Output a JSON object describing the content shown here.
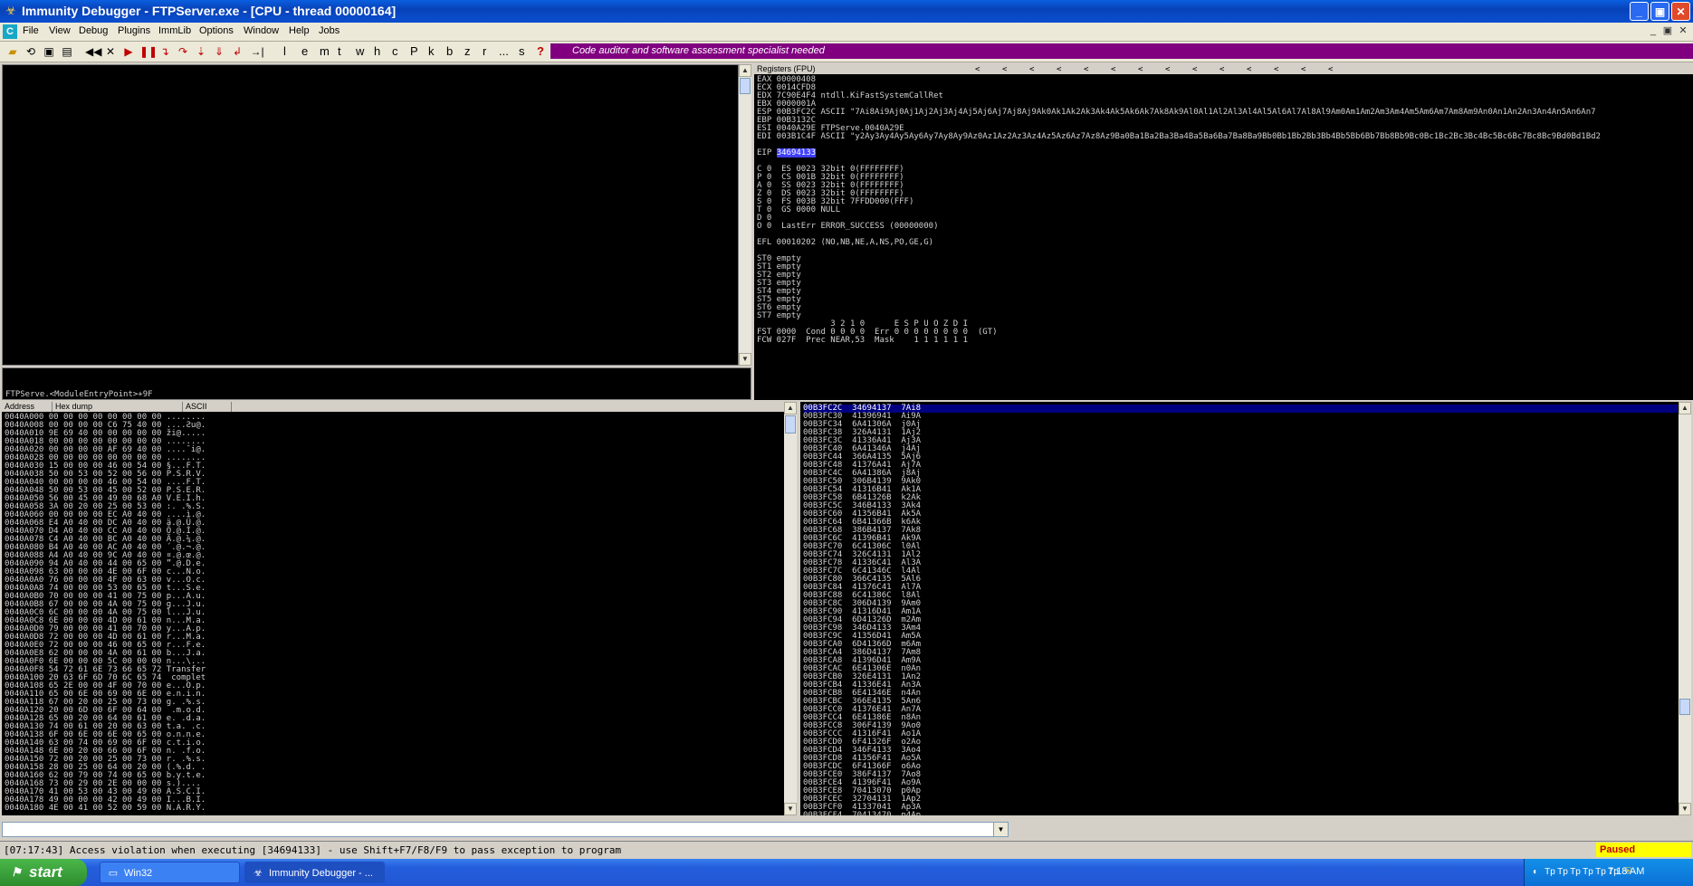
{
  "window": {
    "title": "Immunity Debugger - FTPServer.exe - [CPU - thread 00000164]",
    "minimize": "_",
    "maximize": "▣",
    "close": "✕"
  },
  "menu": {
    "items": [
      "File",
      "View",
      "Debug",
      "Plugins",
      "ImmLib",
      "Options",
      "Window",
      "Help",
      "Jobs"
    ],
    "mdi_controls": [
      "_",
      "▣",
      "✕"
    ]
  },
  "toolbar": {
    "letters": [
      "l",
      "e",
      "m",
      "t",
      "w",
      "h",
      "c",
      "P",
      "k",
      "b",
      "z",
      "r",
      "...",
      "s"
    ],
    "help": "?",
    "banner": "Code auditor and software assessment specialist needed"
  },
  "disasm": {
    "status_line": "FTPServe.<ModuleEntryPoint>+9F"
  },
  "registers": {
    "header": "Registers (FPU)",
    "nav_arrows": [
      "<",
      "<",
      "<",
      "<",
      "<",
      "<",
      "<",
      "<",
      "<",
      "<",
      "<",
      "<",
      "<",
      "<"
    ],
    "lines": [
      "EAX 00000408",
      "ECX 0014CFD8",
      "EDX 7C90E4F4 ntdll.KiFastSystemCallRet",
      "EBX 0000001A",
      "ESP 00B3FC2C ASCII \"7Ai8Ai9Aj0Aj1Aj2Aj3Aj4Aj5Aj6Aj7Aj8Aj9Ak0Ak1Ak2Ak3Ak4Ak5Ak6Ak7Ak8Ak9Al0Al1Al2Al3Al4Al5Al6Al7Al8Al9Am0Am1Am2Am3Am4Am5Am6Am7Am8Am9An0An1An2An3An4An5An6An7",
      "EBP 00B3132C",
      "ESI 0040A29E FTPServe.0040A29E",
      "EDI 003B1C4F ASCII \"y2Ay3Ay4Ay5Ay6Ay7Ay8Ay9Az0Az1Az2Az3Az4Az5Az6Az7Az8Az9Ba0Ba1Ba2Ba3Ba4Ba5Ba6Ba7Ba8Ba9Bb0Bb1Bb2Bb3Bb4Bb5Bb6Bb7Bb8Bb9Bc0Bc1Bc2Bc3Bc4Bc5Bc6Bc7Bc8Bc9Bd0Bd1Bd2",
      "",
      "EIP 34694133",
      "",
      "C 0  ES 0023 32bit 0(FFFFFFFF)",
      "P 0  CS 001B 32bit 0(FFFFFFFF)",
      "A 0  SS 0023 32bit 0(FFFFFFFF)",
      "Z 0  DS 0023 32bit 0(FFFFFFFF)",
      "S 0  FS 003B 32bit 7FFDD000(FFF)",
      "T 0  GS 0000 NULL",
      "D 0",
      "O 0  LastErr ERROR_SUCCESS (00000000)",
      "",
      "EFL 00010202 (NO,NB,NE,A,NS,PO,GE,G)",
      "",
      "ST0 empty",
      "ST1 empty",
      "ST2 empty",
      "ST3 empty",
      "ST4 empty",
      "ST5 empty",
      "ST6 empty",
      "ST7 empty",
      "               3 2 1 0      E S P U O Z D I",
      "FST 0000  Cond 0 0 0 0  Err 0 0 0 0 0 0 0 0  (GT)",
      "FCW 027F  Prec NEAR,53  Mask    1 1 1 1 1 1"
    ]
  },
  "hexdump": {
    "headers": [
      "Address",
      "Hex dump",
      "ASCII"
    ],
    "lines": [
      "0040A000 00 00 00 00 00 00 00 00 ........",
      "0040A008 00 00 00 00 C6 75 40 00 ....Ƨu@.",
      "0040A010 9E 69 40 00 00 00 00 00 ži@.....",
      "0040A018 00 00 00 00 00 00 00 00 ........",
      "0040A020 00 00 00 00 AF 69 40 00 ....¯i@.",
      "0040A028 00 00 00 00 00 00 00 00 ........",
      "0040A030 15 00 00 00 46 00 54 00 §...F.T.",
      "0040A038 50 00 53 00 52 00 56 00 P.S.R.V.",
      "0040A040 00 00 00 00 46 00 54 00 ....F.T.",
      "0040A048 50 00 53 00 45 00 52 00 P.S.E.R.",
      "0040A050 56 00 45 00 49 00 68 A0 V.E.I.h.",
      "0040A058 3A 00 20 00 25 00 53 00 :. .%.S.",
      "0040A060 00 00 00 00 EC A0 40 00 ....ì.@.",
      "0040A068 E4 A0 40 00 DC A0 40 00 ä.@.Ü.@.",
      "0040A070 D4 A0 40 00 CC A0 40 00 Ô.@.Ì.@.",
      "0040A078 C4 A0 40 00 BC A0 40 00 Ä.@.¼.@.",
      "0040A080 B4 A0 40 00 AC A0 40 00 ´.@.¬.@.",
      "0040A088 A4 A0 40 00 9C A0 40 00 ¤.@.œ.@.",
      "0040A090 94 A0 40 00 44 00 65 00 ”.@.D.e.",
      "0040A098 63 00 00 00 4E 00 6F 00 c...N.o.",
      "0040A0A0 76 00 00 00 4F 00 63 00 v...O.c.",
      "0040A0A8 74 00 00 00 53 00 65 00 t...S.e.",
      "0040A0B0 70 00 00 00 41 00 75 00 p...A.u.",
      "0040A0B8 67 00 00 00 4A 00 75 00 g...J.u.",
      "0040A0C0 6C 00 00 00 4A 00 75 00 l...J.u.",
      "0040A0C8 6E 00 00 00 4D 00 61 00 n...M.a.",
      "0040A0D0 79 00 00 00 41 00 70 00 y...A.p.",
      "0040A0D8 72 00 00 00 4D 00 61 00 r...M.a.",
      "0040A0E0 72 00 00 00 46 00 65 00 r...F.e.",
      "0040A0E8 62 00 00 00 4A 00 61 00 b...J.a.",
      "0040A0F0 6E 00 00 00 5C 00 00 00 n...\\...",
      "0040A0F8 54 72 61 6E 73 66 65 72 Transfer",
      "0040A100 20 63 6F 6D 70 6C 65 74  complet",
      "0040A108 65 2E 00 00 4F 00 70 00 e...O.p.",
      "0040A110 65 00 6E 00 69 00 6E 00 e.n.i.n.",
      "0040A118 67 00 20 00 25 00 73 00 g. .%.s.",
      "0040A120 20 00 6D 00 6F 00 64 00  .m.o.d.",
      "0040A128 65 00 20 00 64 00 61 00 e. .d.a.",
      "0040A130 74 00 61 00 20 00 63 00 t.a. .c.",
      "0040A138 6F 00 6E 00 6E 00 65 00 o.n.n.e.",
      "0040A140 63 00 74 00 69 00 6F 00 c.t.i.o.",
      "0040A148 6E 00 20 00 66 00 6F 00 n. .f.o.",
      "0040A150 72 00 20 00 25 00 73 00 r. .%.s.",
      "0040A158 28 00 25 00 64 00 20 00 (.%.d. .",
      "0040A160 62 00 79 00 74 00 65 00 b.y.t.e.",
      "0040A168 73 00 29 00 2E 00 00 00 s.)....",
      "0040A170 41 00 53 00 43 00 49 00 A.S.C.I.",
      "0040A178 49 00 00 00 42 00 49 00 I...B.I.",
      "0040A180 4E 00 41 00 52 00 59 00 N.A.R.Y."
    ]
  },
  "stack": {
    "lines": [
      "00B3FC2C  34694137  7Ai8",
      "00B3FC30  41396941  Ai9A",
      "00B3FC34  6A41306A  j0Aj",
      "00B3FC38  326A4131  1Aj2",
      "00B3FC3C  41336A41  Aj3A",
      "00B3FC40  6A41346A  j4Aj",
      "00B3FC44  366A4135  5Aj6",
      "00B3FC48  41376A41  Aj7A",
      "00B3FC4C  6A41386A  j8Aj",
      "00B3FC50  306B4139  9Ak0",
      "00B3FC54  41316B41  Ak1A",
      "00B3FC58  6B41326B  k2Ak",
      "00B3FC5C  346B4133  3Ak4",
      "00B3FC60  41356B41  Ak5A",
      "00B3FC64  6B41366B  k6Ak",
      "00B3FC68  386B4137  7Ak8",
      "00B3FC6C  41396B41  Ak9A",
      "00B3FC70  6C41306C  l0Al",
      "00B3FC74  326C4131  1Al2",
      "00B3FC78  41336C41  Al3A",
      "00B3FC7C  6C41346C  l4Al",
      "00B3FC80  366C4135  5Al6",
      "00B3FC84  41376C41  Al7A",
      "00B3FC88  6C41386C  l8Al",
      "00B3FC8C  306D4139  9Am0",
      "00B3FC90  41316D41  Am1A",
      "00B3FC94  6D41326D  m2Am",
      "00B3FC98  346D4133  3Am4",
      "00B3FC9C  41356D41  Am5A",
      "00B3FCA0  6D41366D  m6Am",
      "00B3FCA4  386D4137  7Am8",
      "00B3FCA8  41396D41  Am9A",
      "00B3FCAC  6E41306E  n0An",
      "00B3FCB0  326E4131  1An2",
      "00B3FCB4  41336E41  An3A",
      "00B3FCB8  6E41346E  n4An",
      "00B3FCBC  366E4135  5An6",
      "00B3FCC0  41376E41  An7A",
      "00B3FCC4  6E41386E  n8An",
      "00B3FCC8  306F4139  9Ao0",
      "00B3FCCC  41316F41  Ao1A",
      "00B3FCD0  6F41326F  o2Ao",
      "00B3FCD4  346F4133  3Ao4",
      "00B3FCD8  41356F41  Ao5A",
      "00B3FCDC  6F41366F  o6Ao",
      "00B3FCE0  386F4137  7Ao8",
      "00B3FCE4  41396F41  Ao9A",
      "00B3FCE8  70413070  p0Ap",
      "00B3FCEC  32704131  1Ap2",
      "00B3FCF0  41337041  Ap3A",
      "00B3FCF4  70413470  p4Ap"
    ]
  },
  "status": {
    "message": "[07:17:43] Access violation when executing [34694133] - use Shift+F7/F8/F9 to pass exception to program",
    "state": "Paused"
  },
  "taskbar": {
    "start": "start",
    "tasks": [
      {
        "label": "Win32"
      },
      {
        "label": "Immunity Debugger - ..."
      }
    ],
    "tray_icons": [
      "Tp",
      "Tp",
      "Tp",
      "Tp",
      "Tp",
      "Tp"
    ],
    "clock": "7:18 AM"
  },
  "colors": {
    "title_blue": "#0a4fd0",
    "banner_purple": "#800080",
    "eip_highlight": "#4040ff",
    "stack_selected": "#000080",
    "paused_bg": "#ffff00",
    "paused_fg": "#c00000"
  }
}
